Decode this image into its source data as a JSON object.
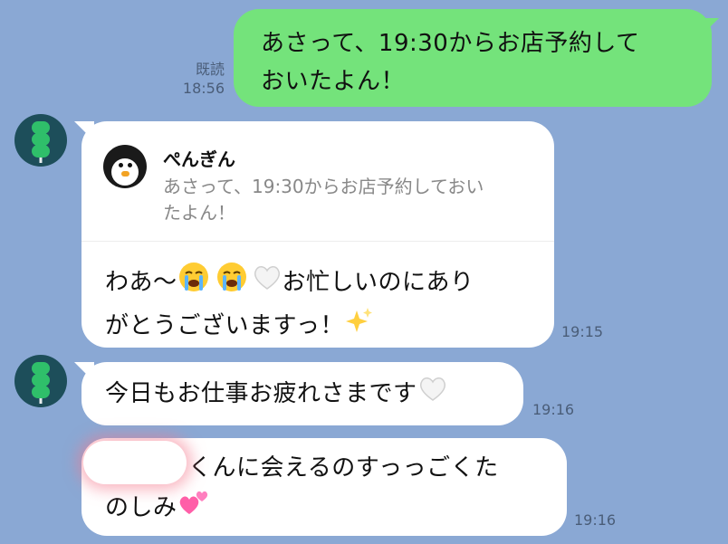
{
  "chat": {
    "messages": [
      {
        "side": "right",
        "text_line1": "あさって、19:30からお店予約して",
        "text_line2": "おいたよん！",
        "read_label": "既読",
        "time": "18:56"
      },
      {
        "side": "left",
        "reply": {
          "name": "ぺんぎん",
          "quote_line1": "あさって、19:30からお店予約しておい",
          "quote_line2": "たよん！"
        },
        "text_line1_a": "わあ〜",
        "text_line1_b": "お忙しいのにあり",
        "text_line2": "がとうございますっ！",
        "time": "19:15"
      },
      {
        "side": "left",
        "text": "今日もお仕事お疲れさまです",
        "time": "19:16"
      },
      {
        "side": "left",
        "text_line1": "くんに会えるのすっっごくた",
        "text_line2": "のしみ",
        "time": "19:16"
      }
    ]
  },
  "icons": {
    "avatar": "green-dango-avatar-icon",
    "reply_avatar": "penguin-avatar-icon",
    "emoji_cry": "loudly-crying-face-icon",
    "emoji_white_heart": "white-heart-icon",
    "emoji_sparkles": "sparkles-icon",
    "emoji_two_hearts": "two-hearts-icon"
  },
  "colors": {
    "background": "#8aa8d4",
    "sent_bubble": "#74e37b",
    "received_bubble": "#ffffff"
  }
}
